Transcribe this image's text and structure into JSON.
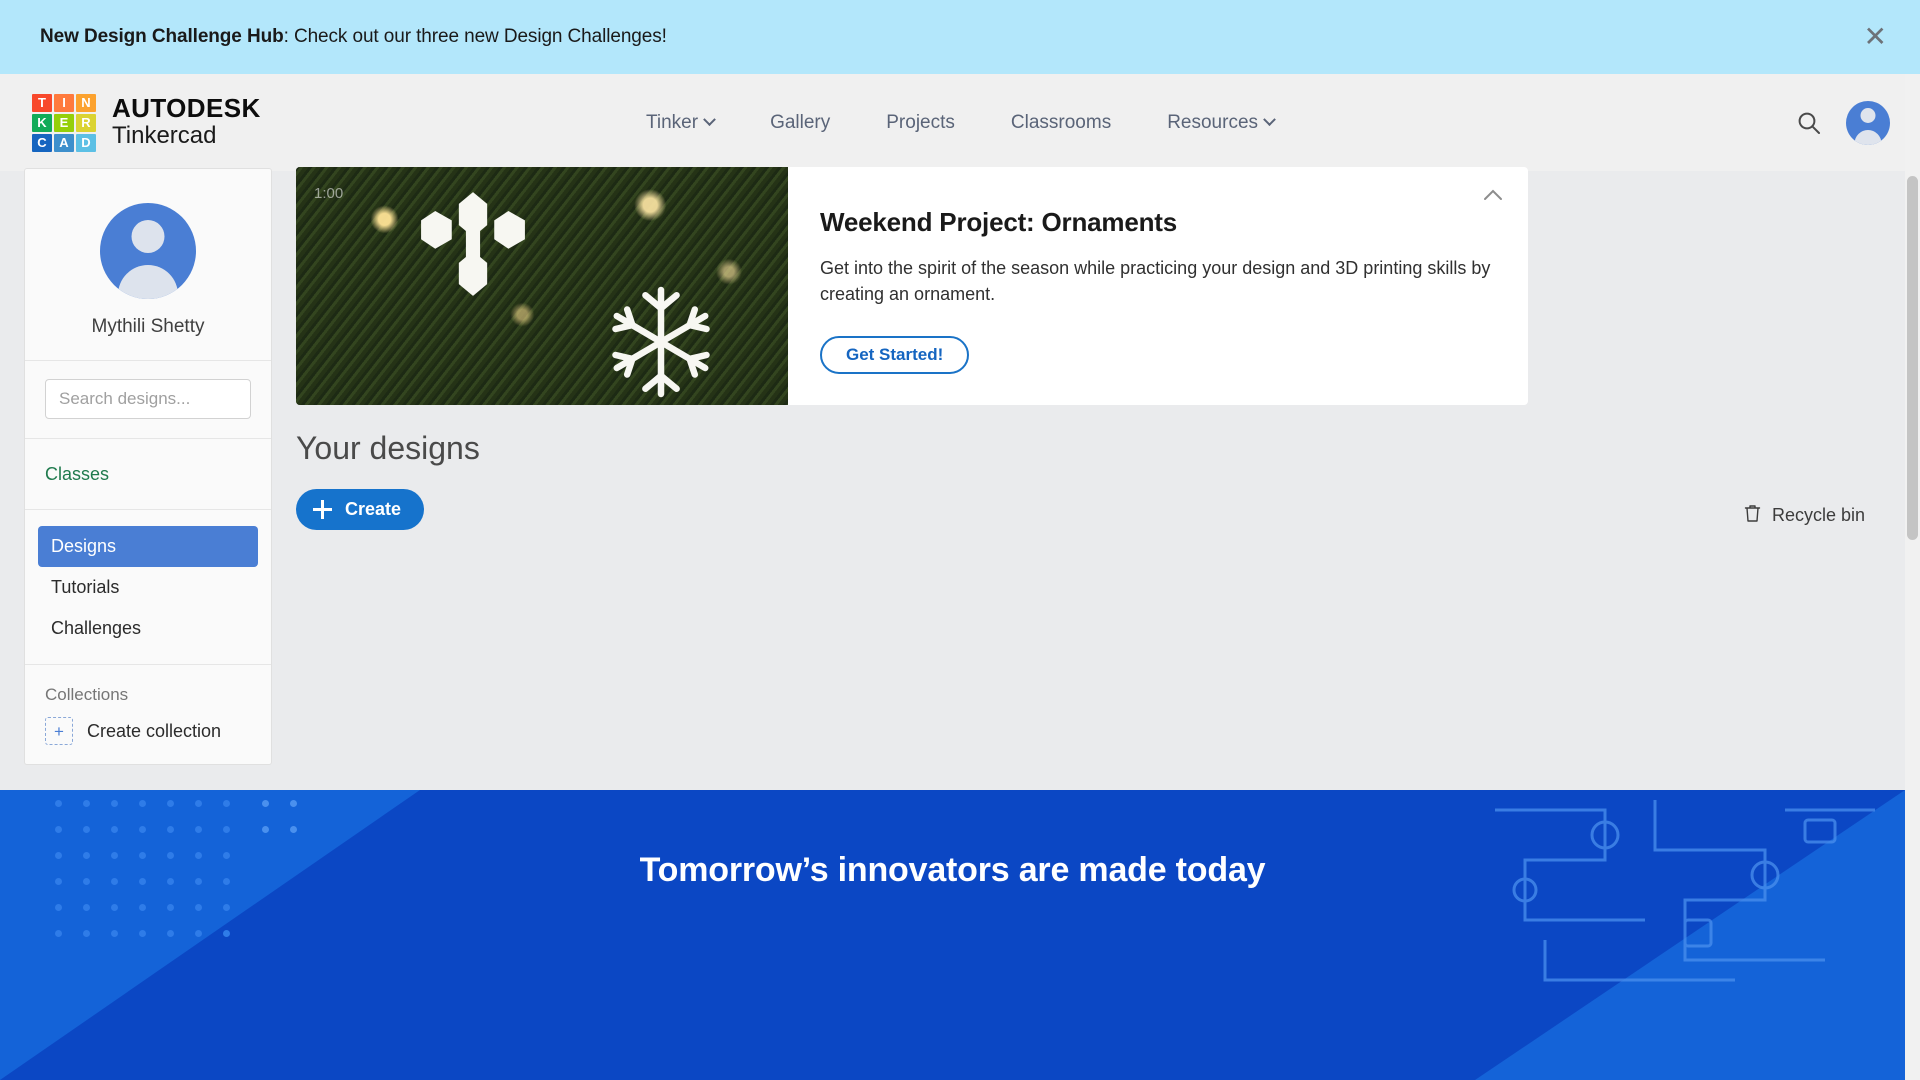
{
  "announcement": {
    "bold_text": "New Design Challenge Hub",
    "rest_text": ": Check out our three new Design Challenges!",
    "close_icon": "close-icon",
    "background": "#b3e7fb"
  },
  "header": {
    "logo": {
      "brand_line1": "AUTODESK",
      "brand_line2": "Tinkercad",
      "cells": [
        {
          "letter": "T",
          "color": "#f8482b"
        },
        {
          "letter": "I",
          "color": "#ff7a3d"
        },
        {
          "letter": "N",
          "color": "#fca22e"
        },
        {
          "letter": "K",
          "color": "#12ab58"
        },
        {
          "letter": "E",
          "color": "#95cf0a"
        },
        {
          "letter": "R",
          "color": "#dbd332"
        },
        {
          "letter": "C",
          "color": "#1565c0"
        },
        {
          "letter": "A",
          "color": "#3d8fcc"
        },
        {
          "letter": "D",
          "color": "#5cc0e5"
        }
      ]
    },
    "nav": [
      {
        "label": "Tinker",
        "has_chevron": true
      },
      {
        "label": "Gallery",
        "has_chevron": false
      },
      {
        "label": "Projects",
        "has_chevron": false
      },
      {
        "label": "Classrooms",
        "has_chevron": false
      },
      {
        "label": "Resources",
        "has_chevron": true
      }
    ],
    "search_icon": "search-icon",
    "account_icon": "user-avatar-icon"
  },
  "sidebar": {
    "username": "Mythili Shetty",
    "search_placeholder": "Search designs...",
    "classes_link": "Classes",
    "items": [
      {
        "label": "Designs",
        "active": true
      },
      {
        "label": "Tutorials",
        "active": false
      },
      {
        "label": "Challenges",
        "active": false
      }
    ],
    "collections_caption": "Collections",
    "create_collection": "Create collection",
    "create_collection_plus": "+"
  },
  "promo": {
    "title": "Weekend Project: Ornaments",
    "description": "Get into the spirit of the season while practicing your design and 3D printing skills by creating an ornament.",
    "cta_label": "Get Started!",
    "image_overlay_time": "1:00",
    "collapse_icon": "chevron-up-icon",
    "image_alt": "snowflake-ornaments-on-christmas-tree"
  },
  "designs": {
    "heading": "Your designs",
    "create_label": "Create",
    "create_icon": "plus-icon",
    "recycle_label": "Recycle bin",
    "recycle_icon": "trash-icon"
  },
  "footer": {
    "title": "Tomorrow’s innovators are made today",
    "background": "#0b47c4"
  },
  "colors": {
    "accent_blue": "#1673cc",
    "active_blue": "#4a7ed4",
    "banner_blue": "#b3e7fb",
    "green_link": "#1f7a4d",
    "footer_blue": "#0b47c4"
  }
}
